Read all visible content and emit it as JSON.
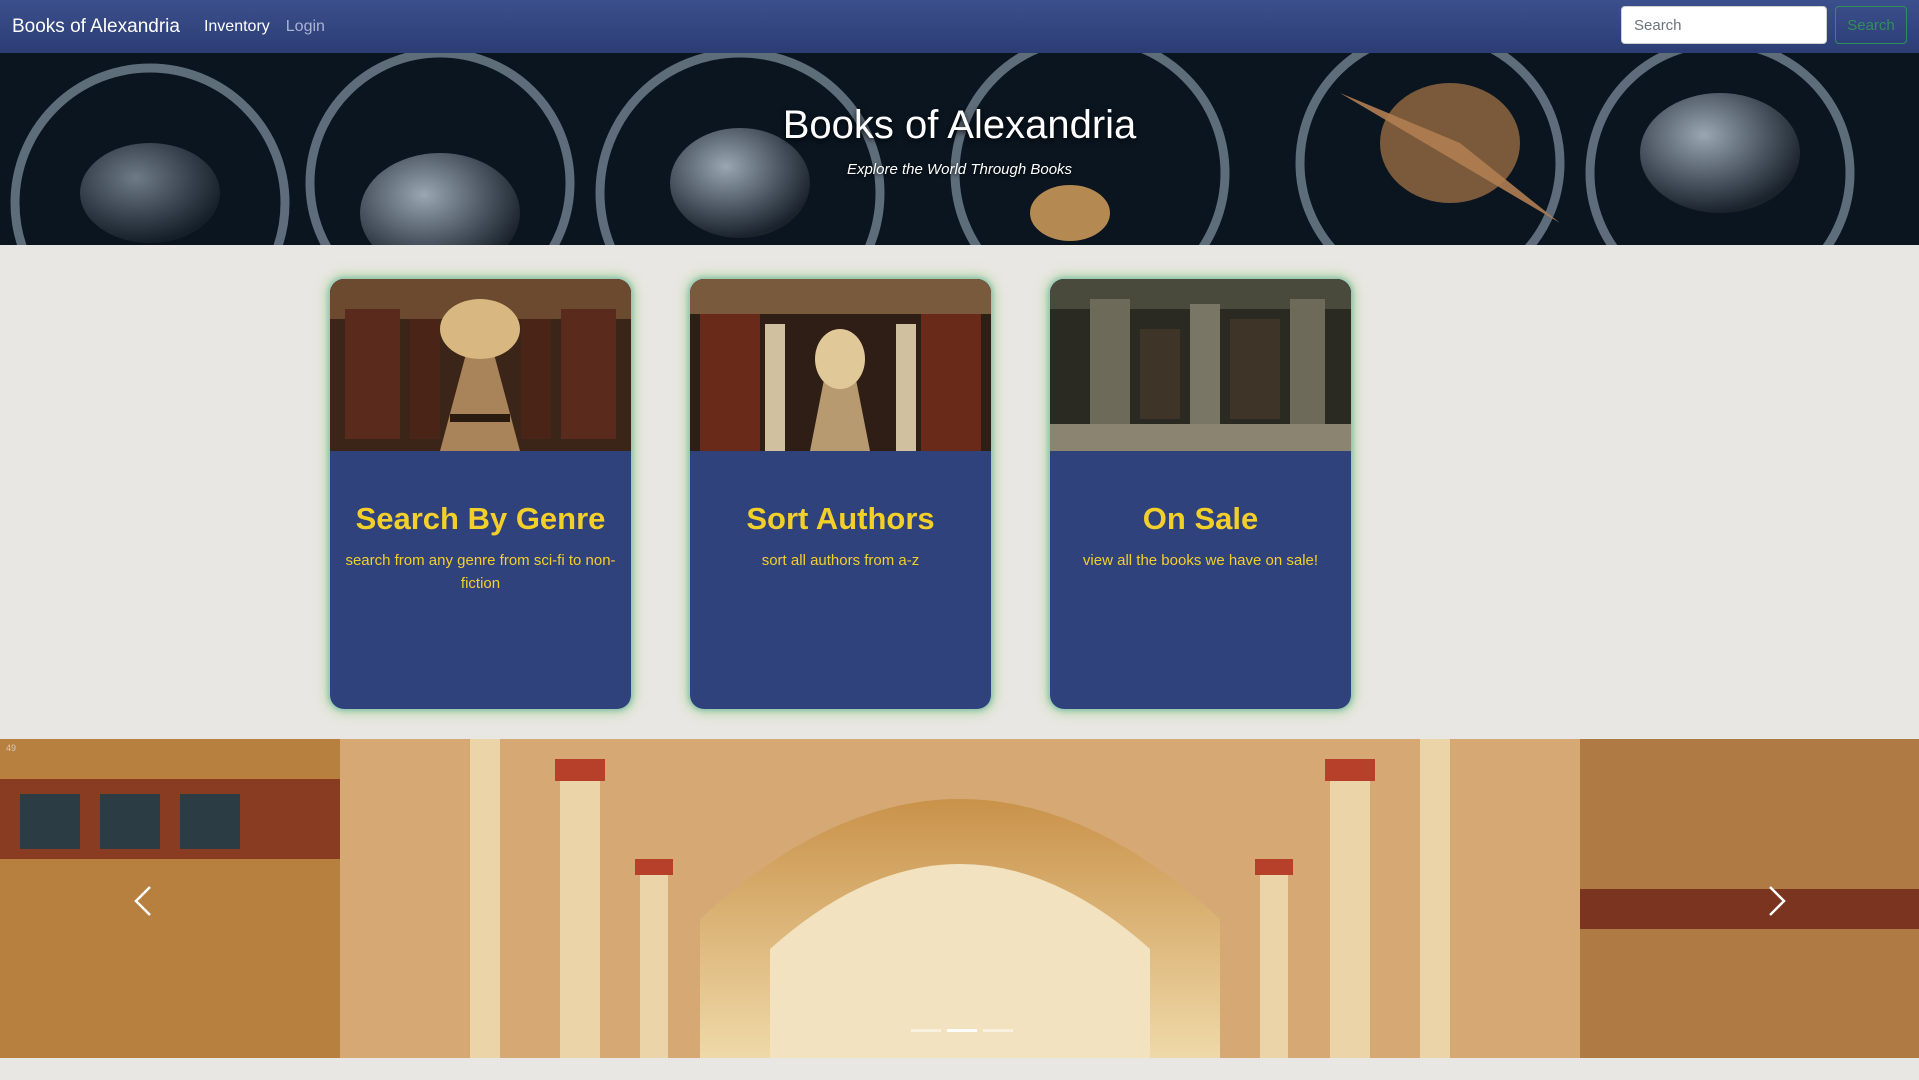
{
  "navbar": {
    "brand": "Books of Alexandria",
    "links": [
      {
        "label": "Inventory",
        "active": true
      },
      {
        "label": "Login",
        "active": false
      }
    ],
    "search_placeholder": "Search",
    "search_button": "Search"
  },
  "hero": {
    "title": "Books of Alexandria",
    "subtitle": "Explore the World Through Books"
  },
  "cards": [
    {
      "title": "Search By Genre",
      "text": "search from any genre from sci-fi to non-fiction"
    },
    {
      "title": "Sort Authors",
      "text": "sort all authors from a-z"
    },
    {
      "title": "On Sale",
      "text": "view all the books we have on sale!"
    }
  ],
  "carousel": {
    "slide_number": "49",
    "prev_icon": "chevron-left-icon",
    "next_icon": "chevron-right-icon",
    "indicator_count": 3,
    "active_indicator": 1
  },
  "colors": {
    "navbar": "#2c3d75",
    "card_bg": "#2f427c",
    "card_text": "#f3cf2a",
    "page_bg": "#e9e7e3",
    "search_button": "#2f8f5a"
  }
}
